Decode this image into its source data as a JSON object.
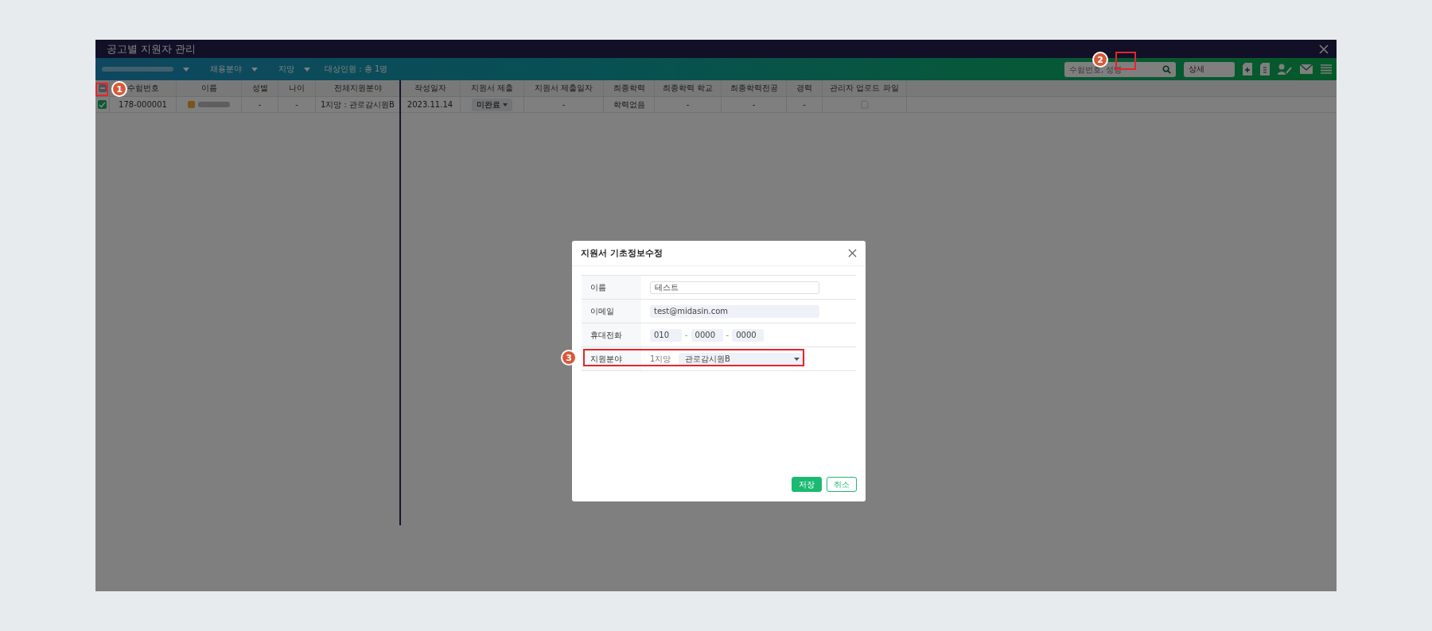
{
  "window": {
    "title": "공고별 지원자 관리"
  },
  "toolbar": {
    "filters": [
      {
        "blurred": true
      },
      {
        "label": "채용분야",
        "blurred": false
      },
      {
        "label": "지망",
        "blurred": false
      }
    ],
    "count": "대상인원 : 총 1명",
    "search": {
      "placeholder": "수험번호, 성명"
    },
    "detail_select": "상세"
  },
  "table": {
    "select_all_partial": true,
    "columns": [
      "수험번호",
      "이름",
      "성별",
      "나이",
      "전체지원분야",
      "작성일자",
      "지원서 제출",
      "지원서 제출일자",
      "최종학력",
      "최종학력 학교",
      "최종학력전공",
      "경력",
      "관리자 업로드 파일"
    ],
    "rows": [
      {
        "checked": true,
        "cells": [
          "178-000001",
          "",
          "-",
          "-",
          "1지망 : 관로감시원B",
          "2023.11.14",
          "미완료",
          "-",
          "학력없음",
          "-",
          "-",
          "-",
          ""
        ]
      }
    ]
  },
  "dialog": {
    "title": "지원서 기초정보수정",
    "fields": [
      {
        "kind": "text",
        "label": "이름",
        "value": "테스트"
      },
      {
        "kind": "readonly",
        "label": "이메일",
        "value": "test@midasin.com"
      },
      {
        "kind": "phone",
        "label": "휴대전화",
        "parts": [
          "010",
          "0000",
          "0000"
        ],
        "separator": "-"
      },
      {
        "kind": "select",
        "label": "지원분야",
        "prefix": "1지망",
        "value": "관로감시원B"
      }
    ],
    "buttons": [
      {
        "label": "저장",
        "primary": true
      },
      {
        "label": "취소",
        "primary": false
      }
    ]
  },
  "annotations": [
    {
      "label": "1"
    },
    {
      "label": "2"
    },
    {
      "label": "3"
    }
  ]
}
